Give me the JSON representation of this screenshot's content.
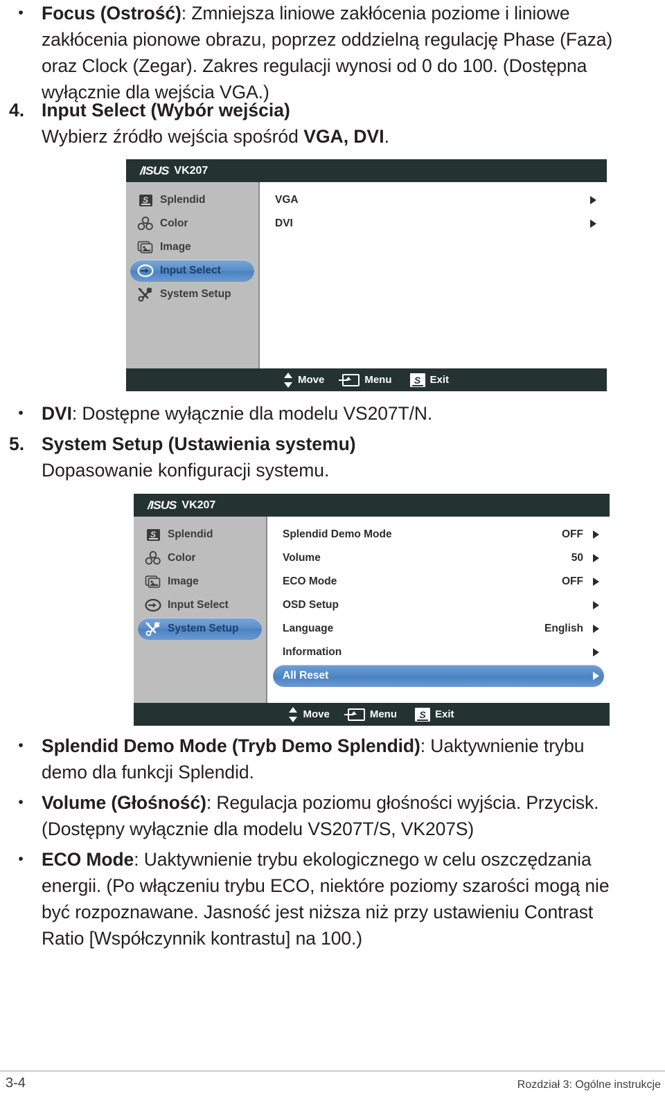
{
  "page": {
    "number": "3-4",
    "chapter": "Rozdział 3: Ogólne instrukcje"
  },
  "doc": {
    "focus_bullet": {
      "mark": "•",
      "term": "Focus (Ostrość)",
      "text": ": Zmniejsza liniowe zakłócenia poziome i liniowe zakłócenia pionowe obrazu, poprzez oddzielną regulację Phase (Faza) oraz Clock (Zegar). Zakres regulacji wynosi od 0 do 100. (Dostępna wyłącznie dla wejścia VGA.)"
    },
    "item4": {
      "mark": "4.",
      "heading": "Input Select (Wybór wejścia)",
      "body_pre": "Wybierz źródło wejścia spośród ",
      "body_bold": "VGA, DVI",
      "body_post": "."
    },
    "dvi_bullet": {
      "mark": "•",
      "term": "DVI",
      "text": ": Dostępne wyłącznie dla modelu VS207T/N."
    },
    "item5": {
      "mark": "5.",
      "heading": "System Setup (Ustawienia systemu)",
      "body": "Dopasowanie konfiguracji systemu."
    },
    "bullets_bottom": [
      {
        "mark": "•",
        "term": "Splendid Demo Mode (Tryb Demo Splendid)",
        "text": ": Uaktywnienie trybu demo dla funkcji Splendid."
      },
      {
        "mark": "•",
        "term": "Volume (Głośność)",
        "text": ": Regulacja poziomu głośności wyjścia. Przycisk. (Dostępny wyłącznie dla modelu VS207T/S, VK207S)"
      },
      {
        "mark": "•",
        "term": "ECO Mode",
        "text": ": Uaktywnienie trybu ekologicznego w celu oszczędzania energii. (Po włączeniu  trybu ECO, niektóre poziomy szarości mogą nie być rozpoznawane. Jasność jest niższa niż przy ustawieniu Contrast Ratio [Współczynnik kontrastu] na 100.)"
      }
    ]
  },
  "colors": {
    "osd_bar": "#24332f",
    "osd_sidebar": "#bdbdbd",
    "highlight_blue": "#4a82c2",
    "text_dark": "#231f20"
  },
  "osd1": {
    "brand": "/ISUS",
    "model": "VK207",
    "sidebar": [
      {
        "label": "Splendid",
        "icon": "splendid-icon",
        "selected": false
      },
      {
        "label": "Color",
        "icon": "color-icon",
        "selected": false
      },
      {
        "label": "Image",
        "icon": "image-icon",
        "selected": false
      },
      {
        "label": "Input Select",
        "icon": "input-select-icon",
        "selected": true
      },
      {
        "label": "System Setup",
        "icon": "system-setup-icon",
        "selected": false
      }
    ],
    "rows": [
      {
        "label": "VGA",
        "value": "",
        "selected": false,
        "arrow": true
      },
      {
        "label": "DVI",
        "value": "",
        "selected": false,
        "arrow": true
      }
    ],
    "footer": [
      {
        "label": "Move",
        "icon": "updown-arrows-icon"
      },
      {
        "label": "Menu",
        "icon": "menu-enter-icon"
      },
      {
        "label": "Exit",
        "icon": "splendid-s-icon"
      }
    ]
  },
  "osd2": {
    "brand": "/ISUS",
    "model": "VK207",
    "sidebar": [
      {
        "label": "Splendid",
        "icon": "splendid-icon",
        "selected": false
      },
      {
        "label": "Color",
        "icon": "color-icon",
        "selected": false
      },
      {
        "label": "Image",
        "icon": "image-icon",
        "selected": false
      },
      {
        "label": "Input Select",
        "icon": "input-select-icon",
        "selected": false
      },
      {
        "label": "System Setup",
        "icon": "system-setup-icon",
        "selected": true
      }
    ],
    "rows": [
      {
        "label": "Splendid Demo Mode",
        "value": "OFF",
        "selected": false,
        "arrow": true
      },
      {
        "label": "Volume",
        "value": "50",
        "selected": false,
        "arrow": true
      },
      {
        "label": "ECO Mode",
        "value": "OFF",
        "selected": false,
        "arrow": true
      },
      {
        "label": "OSD Setup",
        "value": "",
        "selected": false,
        "arrow": true
      },
      {
        "label": "Language",
        "value": "English",
        "selected": false,
        "arrow": true
      },
      {
        "label": "Information",
        "value": "",
        "selected": false,
        "arrow": true
      },
      {
        "label": "All Reset",
        "value": "",
        "selected": true,
        "arrow": true
      }
    ],
    "footer": [
      {
        "label": "Move",
        "icon": "updown-arrows-icon"
      },
      {
        "label": "Menu",
        "icon": "menu-enter-icon"
      },
      {
        "label": "Exit",
        "icon": "splendid-s-icon"
      }
    ]
  }
}
